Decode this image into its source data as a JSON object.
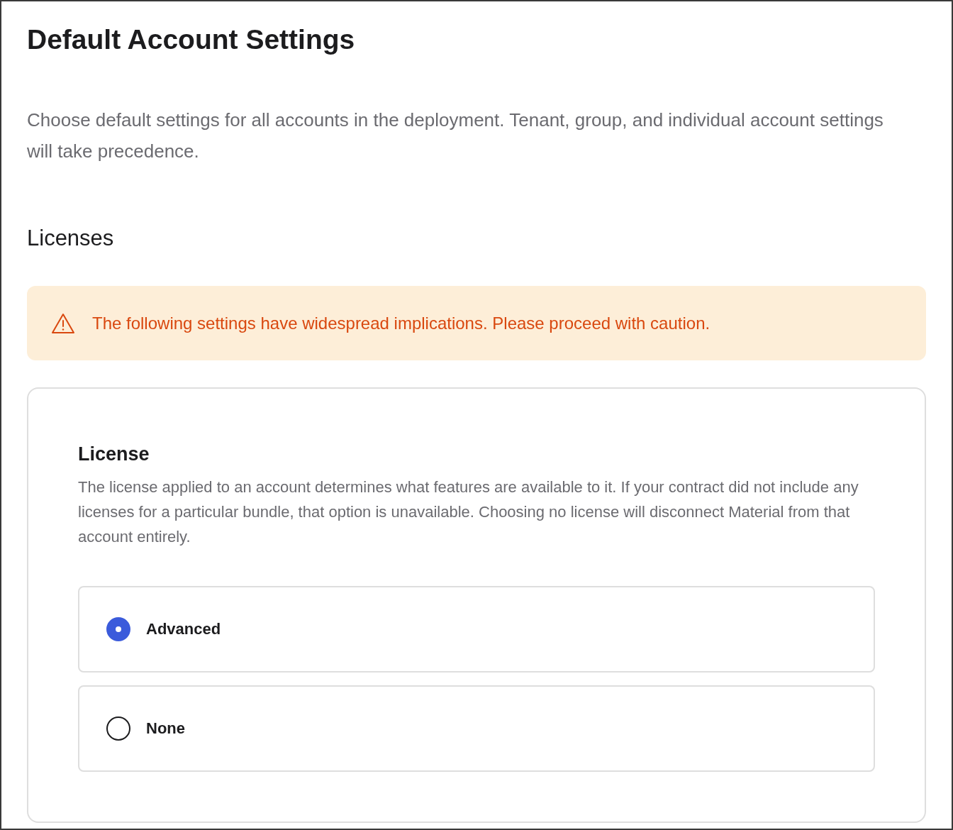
{
  "title": "Default Account Settings",
  "description": "Choose default settings for all accounts in the deployment. Tenant, group, and individual account settings will take precedence.",
  "section": {
    "heading": "Licenses"
  },
  "warning": {
    "text": "The following settings have widespread implications. Please proceed with caution."
  },
  "card": {
    "heading": "License",
    "description": "The license applied to an account determines what features are available to it. If your contract did not include any licenses for a particular bundle, that option is unavailable. Choosing no license will disconnect Material from that account entirely.",
    "options": [
      {
        "label": "Advanced",
        "selected": true
      },
      {
        "label": "None",
        "selected": false
      }
    ]
  }
}
